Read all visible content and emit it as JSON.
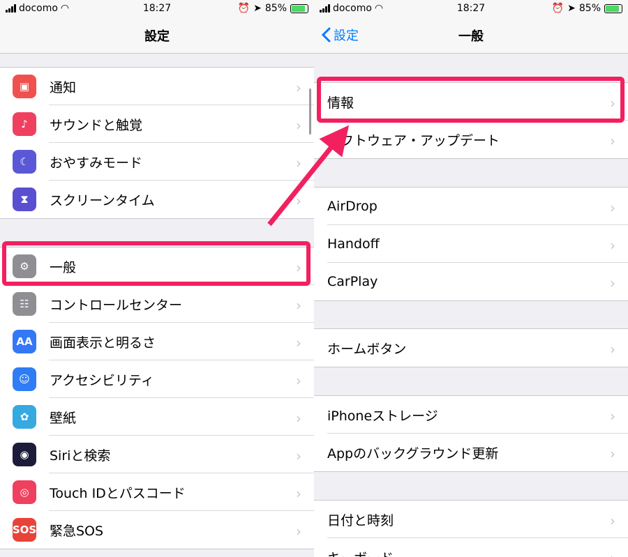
{
  "status": {
    "carrier": "docomo",
    "time": "18:27",
    "battery": "85%"
  },
  "left": {
    "nav_title": "設定",
    "group1": [
      {
        "label": "通知",
        "icon": "notifications-icon",
        "color": "#f0514e",
        "glyph": "▣"
      },
      {
        "label": "サウンドと触覚",
        "icon": "sound-icon",
        "color": "#f0405f",
        "glyph": "♪"
      },
      {
        "label": "おやすみモード",
        "icon": "moon-icon",
        "color": "#5a58d6",
        "glyph": "☾"
      },
      {
        "label": "スクリーンタイム",
        "icon": "hourglass-icon",
        "color": "#5a4fcf",
        "glyph": "⧗"
      }
    ],
    "group2": [
      {
        "label": "一般",
        "icon": "gear-icon",
        "color": "#8e8e93",
        "glyph": "⚙"
      },
      {
        "label": "コントロールセンター",
        "icon": "toggles-icon",
        "color": "#8e8e93",
        "glyph": "☷"
      },
      {
        "label": "画面表示と明るさ",
        "icon": "display-icon",
        "color": "#3478f6",
        "glyph": "AA"
      },
      {
        "label": "アクセシビリティ",
        "icon": "accessibility-icon",
        "color": "#2f7df6",
        "glyph": "☺"
      },
      {
        "label": "壁紙",
        "icon": "wallpaper-icon",
        "color": "#35a9e0",
        "glyph": "✿"
      },
      {
        "label": "Siriと検索",
        "icon": "siri-icon",
        "color": "#1c1c3a",
        "glyph": "◉"
      },
      {
        "label": "Touch IDとパスコード",
        "icon": "fingerprint-icon",
        "color": "#f0405f",
        "glyph": "◎"
      },
      {
        "label": "緊急SOS",
        "icon": "sos-icon",
        "color": "#e8433a",
        "glyph": "SOS"
      }
    ]
  },
  "right": {
    "back_label": "設定",
    "nav_title": "一般",
    "groups": [
      [
        "情報",
        "ソフトウェア・アップデート"
      ],
      [
        "AirDrop",
        "Handoff",
        "CarPlay"
      ],
      [
        "ホームボタン"
      ],
      [
        "iPhoneストレージ",
        "Appのバックグラウンド更新"
      ],
      [
        "日付と時刻",
        "キーボード"
      ]
    ]
  },
  "colors": {
    "highlight": "#f2205f",
    "accent": "#007aff"
  }
}
